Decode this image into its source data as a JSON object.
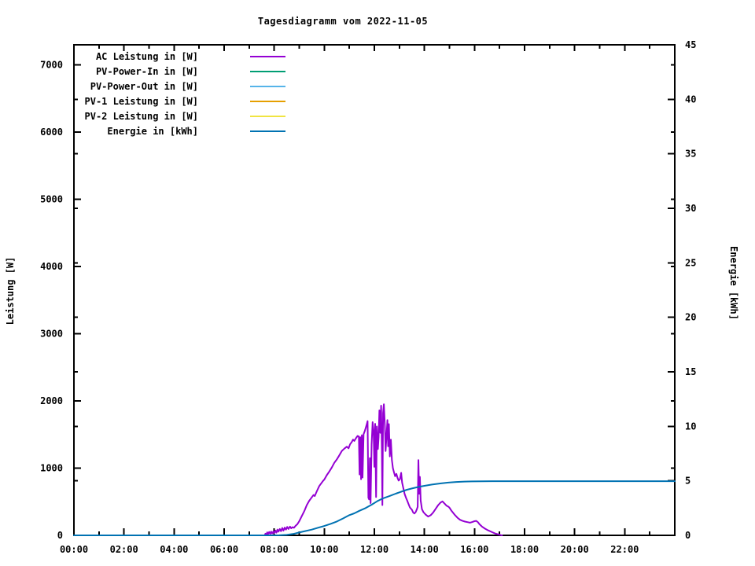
{
  "chart_data": {
    "type": "line",
    "title": "Tagesdiagramm vom 2022-11-05",
    "ylabel": "Leistung [W]",
    "y2label": "Energie [kWh]",
    "legend_position": "top-left-inside",
    "grid": false,
    "x_axis": {
      "min": 0,
      "max": 24,
      "major_ticks": [
        0,
        2,
        4,
        6,
        8,
        10,
        12,
        14,
        16,
        18,
        20,
        22
      ],
      "major_labels": [
        "00:00",
        "02:00",
        "04:00",
        "06:00",
        "08:00",
        "10:00",
        "12:00",
        "14:00",
        "16:00",
        "18:00",
        "20:00",
        "22:00"
      ],
      "minor_ticks": [
        1,
        3,
        5,
        7,
        9,
        11,
        13,
        15,
        17,
        19,
        21,
        23
      ]
    },
    "y_axis": {
      "min": 0,
      "max": 7300,
      "ticks": [
        0,
        1000,
        2000,
        3000,
        4000,
        5000,
        6000,
        7000
      ]
    },
    "y2_axis": {
      "min": 0,
      "max": 45,
      "ticks": [
        0,
        5,
        10,
        15,
        20,
        25,
        30,
        35,
        40,
        45
      ]
    },
    "series": [
      {
        "name": "AC Leistung in [W]",
        "color": "#9400d3",
        "axis": "y1",
        "points": [
          [
            7.62,
            0
          ],
          [
            7.65,
            25
          ],
          [
            7.68,
            8
          ],
          [
            7.72,
            45
          ],
          [
            7.75,
            15
          ],
          [
            7.8,
            50
          ],
          [
            7.84,
            22
          ],
          [
            7.88,
            55
          ],
          [
            7.92,
            28
          ],
          [
            7.97,
            60
          ],
          [
            8.0,
            35
          ],
          [
            8.05,
            70
          ],
          [
            8.09,
            40
          ],
          [
            8.13,
            85
          ],
          [
            8.17,
            55
          ],
          [
            8.22,
            95
          ],
          [
            8.27,
            62
          ],
          [
            8.32,
            110
          ],
          [
            8.37,
            70
          ],
          [
            8.42,
            115
          ],
          [
            8.47,
            85
          ],
          [
            8.52,
            125
          ],
          [
            8.57,
            95
          ],
          [
            8.63,
            130
          ],
          [
            8.68,
            105
          ],
          [
            8.73,
            122
          ],
          [
            8.79,
            112
          ],
          [
            8.85,
            140
          ],
          [
            8.92,
            165
          ],
          [
            9.0,
            210
          ],
          [
            9.1,
            285
          ],
          [
            9.2,
            360
          ],
          [
            9.3,
            450
          ],
          [
            9.4,
            515
          ],
          [
            9.5,
            565
          ],
          [
            9.57,
            600
          ],
          [
            9.62,
            585
          ],
          [
            9.7,
            655
          ],
          [
            9.8,
            735
          ],
          [
            9.88,
            775
          ],
          [
            9.95,
            810
          ],
          [
            10.0,
            830
          ],
          [
            10.1,
            895
          ],
          [
            10.2,
            950
          ],
          [
            10.3,
            1010
          ],
          [
            10.4,
            1080
          ],
          [
            10.5,
            1130
          ],
          [
            10.6,
            1190
          ],
          [
            10.7,
            1255
          ],
          [
            10.8,
            1290
          ],
          [
            10.9,
            1320
          ],
          [
            10.97,
            1295
          ],
          [
            11.03,
            1355
          ],
          [
            11.1,
            1390
          ],
          [
            11.15,
            1425
          ],
          [
            11.2,
            1405
          ],
          [
            11.27,
            1450
          ],
          [
            11.33,
            1480
          ],
          [
            11.38,
            1470
          ],
          [
            11.41,
            905
          ],
          [
            11.44,
            1460
          ],
          [
            11.47,
            835
          ],
          [
            11.5,
            1490
          ],
          [
            11.53,
            860
          ],
          [
            11.57,
            1505
          ],
          [
            11.62,
            1555
          ],
          [
            11.66,
            1605
          ],
          [
            11.7,
            1655
          ],
          [
            11.73,
            1700
          ],
          [
            11.76,
            560
          ],
          [
            11.79,
            535
          ],
          [
            11.82,
            1150
          ],
          [
            11.85,
            480
          ],
          [
            11.89,
            1350
          ],
          [
            11.93,
            1685
          ],
          [
            11.97,
            1545
          ],
          [
            12.0,
            1020
          ],
          [
            12.03,
            1660
          ],
          [
            12.07,
            570
          ],
          [
            12.1,
            1620
          ],
          [
            12.14,
            1285
          ],
          [
            12.17,
            1455
          ],
          [
            12.2,
            1860
          ],
          [
            12.24,
            1525
          ],
          [
            12.27,
            1930
          ],
          [
            12.3,
            1265
          ],
          [
            12.32,
            450
          ],
          [
            12.35,
            1820
          ],
          [
            12.38,
            1950
          ],
          [
            12.42,
            1625
          ],
          [
            12.45,
            1255
          ],
          [
            12.49,
            1505
          ],
          [
            12.52,
            1715
          ],
          [
            12.55,
            1325
          ],
          [
            12.58,
            1655
          ],
          [
            12.62,
            1175
          ],
          [
            12.66,
            1425
          ],
          [
            12.7,
            1120
          ],
          [
            12.74,
            1000
          ],
          [
            12.78,
            945
          ],
          [
            12.83,
            880
          ],
          [
            12.88,
            915
          ],
          [
            12.93,
            850
          ],
          [
            12.97,
            815
          ],
          [
            13.02,
            835
          ],
          [
            13.07,
            930
          ],
          [
            13.11,
            785
          ],
          [
            13.16,
            700
          ],
          [
            13.21,
            615
          ],
          [
            13.27,
            555
          ],
          [
            13.31,
            520
          ],
          [
            13.36,
            470
          ],
          [
            13.42,
            415
          ],
          [
            13.5,
            380
          ],
          [
            13.55,
            340
          ],
          [
            13.6,
            325
          ],
          [
            13.65,
            345
          ],
          [
            13.7,
            390
          ],
          [
            13.73,
            425
          ],
          [
            13.76,
            1120
          ],
          [
            13.79,
            620
          ],
          [
            13.82,
            870
          ],
          [
            13.85,
            520
          ],
          [
            13.9,
            390
          ],
          [
            13.96,
            345
          ],
          [
            14.05,
            308
          ],
          [
            14.15,
            280
          ],
          [
            14.25,
            300
          ],
          [
            14.35,
            340
          ],
          [
            14.45,
            395
          ],
          [
            14.55,
            450
          ],
          [
            14.65,
            490
          ],
          [
            14.72,
            505
          ],
          [
            14.8,
            475
          ],
          [
            14.88,
            442
          ],
          [
            14.95,
            428
          ],
          [
            15.0,
            412
          ],
          [
            15.07,
            372
          ],
          [
            15.14,
            338
          ],
          [
            15.22,
            302
          ],
          [
            15.32,
            262
          ],
          [
            15.42,
            232
          ],
          [
            15.52,
            215
          ],
          [
            15.62,
            205
          ],
          [
            15.72,
            196
          ],
          [
            15.82,
            188
          ],
          [
            15.92,
            200
          ],
          [
            16.0,
            210
          ],
          [
            16.07,
            215
          ],
          [
            16.14,
            194
          ],
          [
            16.2,
            165
          ],
          [
            16.3,
            130
          ],
          [
            16.42,
            100
          ],
          [
            16.55,
            74
          ],
          [
            16.7,
            48
          ],
          [
            16.82,
            28
          ],
          [
            16.95,
            14
          ],
          [
            17.05,
            4
          ],
          [
            17.1,
            0
          ]
        ]
      },
      {
        "name": "PV-Power-In in [W]",
        "color": "#009e73",
        "axis": "y1",
        "points": []
      },
      {
        "name": "PV-Power-Out in [W]",
        "color": "#56b4e9",
        "axis": "y1",
        "points": []
      },
      {
        "name": "PV-1 Leistung in [W]",
        "color": "#e69f00",
        "axis": "y1",
        "points": []
      },
      {
        "name": "PV-2 Leistung in [W]",
        "color": "#f0e442",
        "axis": "y1",
        "points": []
      },
      {
        "name": "Energie in [kWh]",
        "color": "#0072b2",
        "axis": "y2",
        "points": [
          [
            0,
            0
          ],
          [
            7.5,
            0
          ],
          [
            8.2,
            0.01
          ],
          [
            8.5,
            0.04
          ],
          [
            8.75,
            0.12
          ],
          [
            9.0,
            0.27
          ],
          [
            9.25,
            0.4
          ],
          [
            9.5,
            0.53
          ],
          [
            9.75,
            0.7
          ],
          [
            10.0,
            0.86
          ],
          [
            10.25,
            1.05
          ],
          [
            10.5,
            1.27
          ],
          [
            10.75,
            1.55
          ],
          [
            11.0,
            1.85
          ],
          [
            11.2,
            2.02
          ],
          [
            11.4,
            2.25
          ],
          [
            11.65,
            2.5
          ],
          [
            11.9,
            2.82
          ],
          [
            12.13,
            3.15
          ],
          [
            12.35,
            3.4
          ],
          [
            12.6,
            3.6
          ],
          [
            12.85,
            3.82
          ],
          [
            13.07,
            4.0
          ],
          [
            13.3,
            4.18
          ],
          [
            13.53,
            4.32
          ],
          [
            13.77,
            4.44
          ],
          [
            14.0,
            4.54
          ],
          [
            14.3,
            4.66
          ],
          [
            14.63,
            4.76
          ],
          [
            14.95,
            4.84
          ],
          [
            15.27,
            4.9
          ],
          [
            15.6,
            4.93
          ],
          [
            15.9,
            4.95
          ],
          [
            16.3,
            4.96
          ],
          [
            16.7,
            4.97
          ],
          [
            17.2,
            4.97
          ],
          [
            18.0,
            4.97
          ],
          [
            19.0,
            4.97
          ],
          [
            20.0,
            4.97
          ],
          [
            21.0,
            4.97
          ],
          [
            22.0,
            4.97
          ],
          [
            23.0,
            4.97
          ],
          [
            24.0,
            4.97
          ]
        ]
      }
    ]
  }
}
